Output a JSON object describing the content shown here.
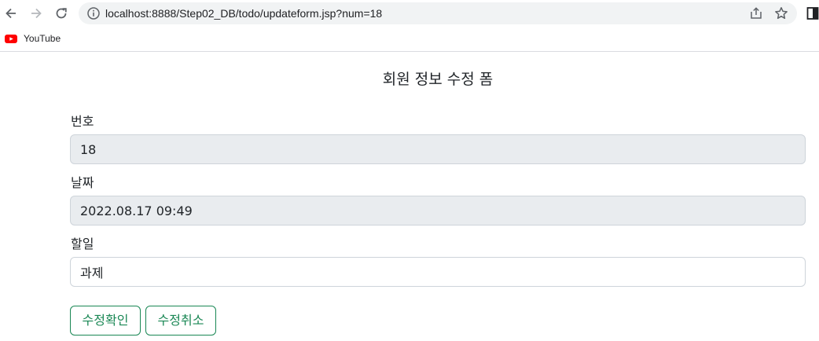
{
  "browser": {
    "url": "localhost:8888/Step02_DB/todo/updateform.jsp?num=18",
    "icons": {
      "back": "arrow-left-icon",
      "forward": "arrow-right-icon",
      "reload": "reload-icon",
      "info": "info-icon",
      "share": "share-icon",
      "bookmark": "star-icon",
      "side_panel": "side-panel-icon"
    },
    "bookmarks": [
      {
        "label": "YouTube",
        "icon": "youtube-icon",
        "color": "#ff0000"
      }
    ]
  },
  "form": {
    "title": "회원 정보 수정 폼",
    "fields": [
      {
        "label": "번호",
        "value": "18",
        "readonly": true
      },
      {
        "label": "날짜",
        "value": "2022.08.17 09:49",
        "readonly": true
      },
      {
        "label": "할일",
        "value": "과제",
        "readonly": false
      }
    ],
    "buttons": {
      "submit_label": "수정확인",
      "cancel_label": "수정취소",
      "color": "#198754"
    }
  }
}
